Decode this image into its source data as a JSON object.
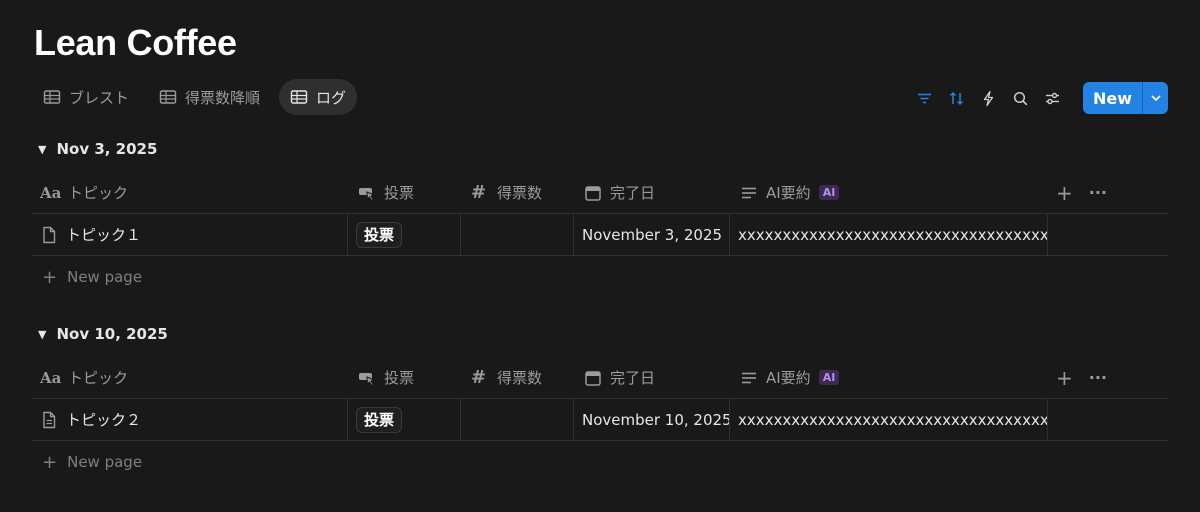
{
  "page": {
    "title": "Lean Coffee"
  },
  "views": [
    {
      "label": "ブレスト",
      "active": false
    },
    {
      "label": "得票数降順",
      "active": false
    },
    {
      "label": "ログ",
      "active": true
    }
  ],
  "toolbar": {
    "icons": [
      "filter-icon",
      "sort-icon",
      "automation-bolt-icon",
      "search-icon",
      "settings-sliders-icon"
    ],
    "new_label": "New",
    "accent": "#2383e2"
  },
  "columns": {
    "topic": "トピック",
    "vote": "投票",
    "count": "得票数",
    "done": "完了日",
    "ai": "AI要約",
    "ai_badge": "AI"
  },
  "groups": [
    {
      "date": "Nov 3, 2025",
      "rows": [
        {
          "topic": "トピック１",
          "vote": "投票",
          "count": "",
          "done": "November 3, 2025",
          "ai": "xxxxxxxxxxxxxxxxxxxxxxxxxxxxxxxxxxxxxxxxxxxxxx"
        }
      ]
    },
    {
      "date": "Nov 10, 2025",
      "rows": [
        {
          "topic": "トピック２",
          "vote": "投票",
          "count": "",
          "done": "November 10, 2025",
          "ai": "xxxxxxxxxxxxxxxxxxxxxxxxxxxxxxxxxxxxxxxxxxxxxx"
        }
      ]
    }
  ],
  "new_page_label": "New page"
}
